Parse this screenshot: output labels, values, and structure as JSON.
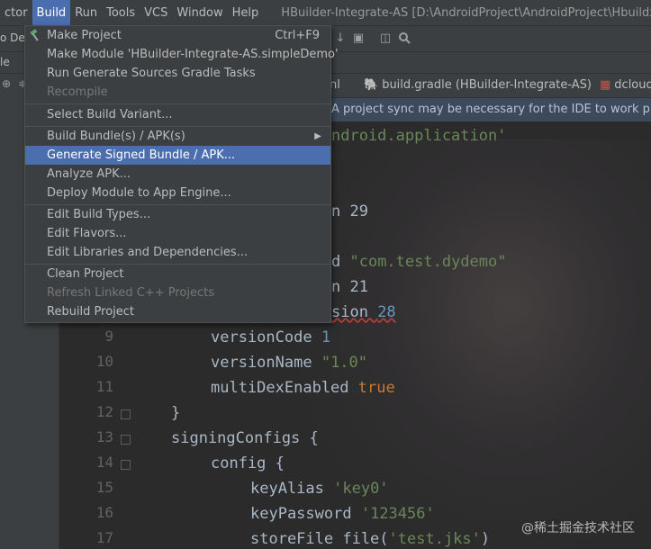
{
  "menubar": {
    "items": [
      "ctor",
      "Build",
      "Run",
      "Tools",
      "VCS",
      "Window",
      "Help"
    ],
    "active": "Build",
    "window_title": "HBuilder-Integrate-AS [D:\\AndroidProject\\AndroidProject\\HbuildxProject"
  },
  "toolbar": {
    "left_text": "o De"
  },
  "navrow": {
    "left_text": "le"
  },
  "tabs": [
    {
      "label": "nl"
    },
    {
      "label": "build.gradle (HBuilder-Integrate-AS)"
    },
    {
      "label": "dcloud"
    }
  ],
  "notice": {
    "text": "A project sync may be necessary for the IDE to work properly"
  },
  "build_menu": {
    "items": [
      {
        "label": "Make Project",
        "shortcut": "Ctrl+F9",
        "icon": "hammer-icon"
      },
      {
        "label": "Make Module 'HBuilder-Integrate-AS.simpleDemo'"
      },
      {
        "label": "Run Generate Sources Gradle Tasks"
      },
      {
        "label": "Recompile",
        "disabled": true
      },
      {
        "label": "Select Build Variant..."
      },
      {
        "label": "Build Bundle(s) / APK(s)",
        "submenu": true
      },
      {
        "label": "Generate Signed Bundle / APK...",
        "highlighted": true
      },
      {
        "label": "Analyze APK..."
      },
      {
        "label": "Deploy Module to App Engine..."
      },
      {
        "label": "Edit Build Types..."
      },
      {
        "label": "Edit Flavors..."
      },
      {
        "label": "Edit Libraries and Dependencies..."
      },
      {
        "label": "Clean Project"
      },
      {
        "label": "Refresh Linked C++ Projects",
        "disabled": true
      },
      {
        "label": "Rebuild Project"
      }
    ]
  },
  "editor": {
    "gutter": [
      "9",
      "10",
      "11",
      "12",
      "13",
      "14",
      "15",
      "16",
      "17"
    ],
    "code": {
      "l1": "ndroid.application'",
      "l2": "n 29",
      "l3a": "d ",
      "l3b": "\"com.test.dydemo\"",
      "l4": "n 21",
      "l5a": "sion ",
      "l5b": "28",
      "l6a": "versionCode ",
      "l6b": "1",
      "l7a": "versionName ",
      "l7b": "\"1.0\"",
      "l8a": "multiDexEnabled ",
      "l8b": "true",
      "l9": "}",
      "l10": "signingConfigs {",
      "l11": "config {",
      "l12a": "keyAlias ",
      "l12b": "'key0'",
      "l13a": "keyPassword ",
      "l13b": "'123456'",
      "l14a": "storeFile file(",
      "l14b": "'test.jks'",
      "l14c": ")"
    }
  },
  "watermark": "@稀土掘金技术社区",
  "colors": {
    "menu_highlight": "#4b6eaf",
    "background": "#2b2b2b",
    "panel": "#3c3f41",
    "string": "#6a8759",
    "number": "#6897bb",
    "keyword": "#cc7832"
  }
}
